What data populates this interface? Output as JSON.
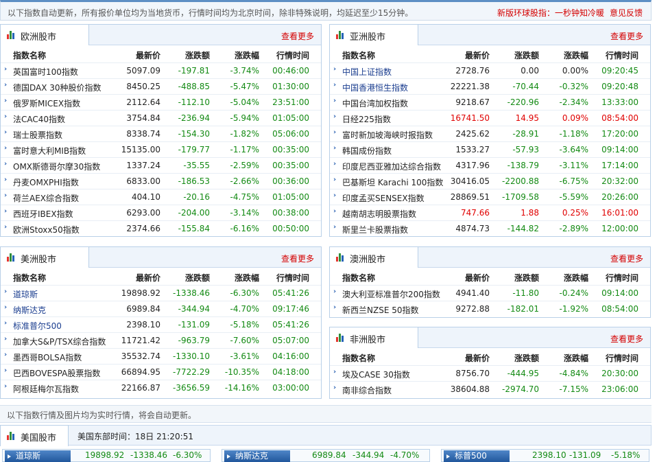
{
  "notice": {
    "text": "以下指数自动更新，所有报价单位均为当地货币，行情时间均为北京时间，除非特殊说明，均延迟至少15分钟。",
    "link1": "新版环球股指：一秒钟知冷暖",
    "link2": "意见反馈"
  },
  "columns": {
    "name": "指数名称",
    "price": "最新价",
    "change": "涨跌额",
    "pct": "涨跌幅",
    "time": "行情时间"
  },
  "more_label": "查看更多",
  "icon_colors": [
    "#e5322d",
    "#2f8e3a",
    "#2563b8"
  ],
  "colors": {
    "down": "#138a13",
    "up": "#e00000"
  },
  "europe": {
    "title": "欧洲股市",
    "rows": [
      {
        "name": "英国富时100指数",
        "price": "5097.09",
        "change": "-197.81",
        "pct": "-3.74%",
        "time": "00:46:00",
        "dir": "down"
      },
      {
        "name": "德国DAX 30种股价指数",
        "price": "8450.25",
        "change": "-488.85",
        "pct": "-5.47%",
        "time": "01:30:00",
        "dir": "down"
      },
      {
        "name": "俄罗斯MICEX指数",
        "price": "2112.64",
        "change": "-112.10",
        "pct": "-5.04%",
        "time": "23:51:00",
        "dir": "down"
      },
      {
        "name": "法CAC40指数",
        "price": "3754.84",
        "change": "-236.94",
        "pct": "-5.94%",
        "time": "01:05:00",
        "dir": "down"
      },
      {
        "name": "瑞士股票指数",
        "price": "8338.74",
        "change": "-154.30",
        "pct": "-1.82%",
        "time": "05:06:00",
        "dir": "down"
      },
      {
        "name": "富时意大利MIB指数",
        "price": "15135.00",
        "change": "-179.77",
        "pct": "-1.17%",
        "time": "00:35:00",
        "dir": "down"
      },
      {
        "name": "OMX斯德哥尔摩30指数",
        "price": "1337.24",
        "change": "-35.55",
        "pct": "-2.59%",
        "time": "00:35:00",
        "dir": "down"
      },
      {
        "name": "丹麦OMXPHI指数",
        "price": "6833.00",
        "change": "-186.53",
        "pct": "-2.66%",
        "time": "00:36:00",
        "dir": "down"
      },
      {
        "name": "荷兰AEX综合指数",
        "price": "404.10",
        "change": "-20.16",
        "pct": "-4.75%",
        "time": "01:05:00",
        "dir": "down"
      },
      {
        "name": "西班牙IBEX指数",
        "price": "6293.00",
        "change": "-204.00",
        "pct": "-3.14%",
        "time": "00:38:00",
        "dir": "down"
      },
      {
        "name": "欧洲Stoxx50指数",
        "price": "2374.66",
        "change": "-155.84",
        "pct": "-6.16%",
        "time": "00:50:00",
        "dir": "down"
      }
    ]
  },
  "asia": {
    "title": "亚洲股市",
    "rows": [
      {
        "name": "中国上证指数",
        "price": "2728.76",
        "change": "0.00",
        "pct": "0.00%",
        "time": "09:20:45",
        "dir": "flat",
        "link": true
      },
      {
        "name": "中国香港恒生指数",
        "price": "22221.38",
        "change": "-70.44",
        "pct": "-0.32%",
        "time": "09:20:48",
        "dir": "down",
        "link": true
      },
      {
        "name": "中国台湾加权指数",
        "price": "9218.67",
        "change": "-220.96",
        "pct": "-2.34%",
        "time": "13:33:00",
        "dir": "down"
      },
      {
        "name": "日经225指数",
        "price": "16741.50",
        "change": "14.95",
        "pct": "0.09%",
        "time": "08:54:00",
        "dir": "up"
      },
      {
        "name": "富时新加坡海峡时报指数",
        "price": "2425.62",
        "change": "-28.91",
        "pct": "-1.18%",
        "time": "17:20:00",
        "dir": "down"
      },
      {
        "name": "韩国成份指数",
        "price": "1533.27",
        "change": "-57.93",
        "pct": "-3.64%",
        "time": "09:14:00",
        "dir": "down"
      },
      {
        "name": "印度尼西亚雅加达综合指数",
        "price": "4317.96",
        "change": "-138.79",
        "pct": "-3.11%",
        "time": "17:14:00",
        "dir": "down"
      },
      {
        "name": "巴基斯坦 Karachi 100指数",
        "price": "30416.05",
        "change": "-2200.88",
        "pct": "-6.75%",
        "time": "20:32:00",
        "dir": "down"
      },
      {
        "name": "印度孟买SENSEX指数",
        "price": "28869.51",
        "change": "-1709.58",
        "pct": "-5.59%",
        "time": "20:26:00",
        "dir": "down"
      },
      {
        "name": "越南胡志明股票指数",
        "price": "747.66",
        "change": "1.88",
        "pct": "0.25%",
        "time": "16:01:00",
        "dir": "up"
      },
      {
        "name": "斯里兰卡股票指数",
        "price": "4874.73",
        "change": "-144.82",
        "pct": "-2.89%",
        "time": "12:00:00",
        "dir": "down"
      }
    ]
  },
  "america": {
    "title": "美洲股市",
    "rows": [
      {
        "name": "道琼斯",
        "price": "19898.92",
        "change": "-1338.46",
        "pct": "-6.30%",
        "time": "05:41:26",
        "dir": "down",
        "link": true
      },
      {
        "name": "纳斯达克",
        "price": "6989.84",
        "change": "-344.94",
        "pct": "-4.70%",
        "time": "09:17:46",
        "dir": "down",
        "link": true
      },
      {
        "name": "标准普尔500",
        "price": "2398.10",
        "change": "-131.09",
        "pct": "-5.18%",
        "time": "05:41:26",
        "dir": "down",
        "link": true
      },
      {
        "name": "加拿大S&P/TSX综合指数",
        "price": "11721.42",
        "change": "-963.79",
        "pct": "-7.60%",
        "time": "05:07:00",
        "dir": "down"
      },
      {
        "name": "墨西哥BOLSA指数",
        "price": "35532.74",
        "change": "-1330.10",
        "pct": "-3.61%",
        "time": "04:16:00",
        "dir": "down"
      },
      {
        "name": "巴西BOVESPA股票指数",
        "price": "66894.95",
        "change": "-7722.29",
        "pct": "-10.35%",
        "time": "04:18:00",
        "dir": "down"
      },
      {
        "name": "阿根廷梅尔瓦指数",
        "price": "22166.87",
        "change": "-3656.59",
        "pct": "-14.16%",
        "time": "03:00:00",
        "dir": "down"
      }
    ]
  },
  "oceania": {
    "title": "澳洲股市",
    "rows": [
      {
        "name": "澳大利亚标准普尔200指数",
        "price": "4941.40",
        "change": "-11.80",
        "pct": "-0.24%",
        "time": "09:14:00",
        "dir": "down"
      },
      {
        "name": "新西兰NZSE 50指数",
        "price": "9272.88",
        "change": "-182.01",
        "pct": "-1.92%",
        "time": "08:54:00",
        "dir": "down"
      }
    ]
  },
  "africa": {
    "title": "非洲股市",
    "rows": [
      {
        "name": "埃及CASE 30指数",
        "price": "8756.70",
        "change": "-444.95",
        "pct": "-4.84%",
        "time": "20:30:00",
        "dir": "down"
      },
      {
        "name": "南非综合指数",
        "price": "38604.88",
        "change": "-2974.70",
        "pct": "-7.15%",
        "time": "23:06:00",
        "dir": "down"
      }
    ]
  },
  "notice2": "以下指数行情及图片均为实时行情，将会自动更新。",
  "us_bar": {
    "title": "美国股市",
    "time_text": "美国东部时间：18日 21:20:51"
  },
  "tickers": [
    {
      "name": "道琼斯",
      "price": "19898.92",
      "change": "-1338.46",
      "pct": "-6.30%"
    },
    {
      "name": "纳斯达克",
      "price": "6989.84",
      "change": "-344.94",
      "pct": "-4.70%"
    },
    {
      "name": "标普500",
      "price": "2398.10",
      "change": "-131.09",
      "pct": "-5.18%"
    }
  ]
}
